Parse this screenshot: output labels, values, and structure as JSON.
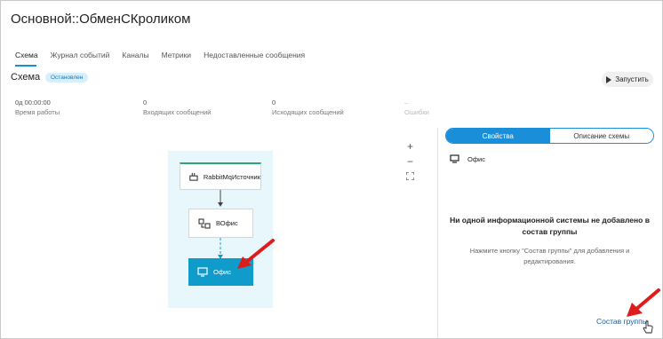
{
  "page": {
    "title": "Основной::ОбменСКроликом"
  },
  "tabs": [
    {
      "label": "Схема",
      "active": true
    },
    {
      "label": "Журнал событий",
      "active": false
    },
    {
      "label": "Каналы",
      "active": false
    },
    {
      "label": "Метрики",
      "active": false
    },
    {
      "label": "Недоставленные сообщения",
      "active": false
    }
  ],
  "schema": {
    "title": "Схема",
    "status": "Остановлен",
    "run_label": "Запустить"
  },
  "stats": [
    {
      "value": "0д 00:00:00",
      "label": "Время работы"
    },
    {
      "value": "0",
      "label": "Входящих сообщений"
    },
    {
      "value": "0",
      "label": "Исходящих сообщений"
    },
    {
      "value": "–",
      "label": "Ошибки"
    }
  ],
  "diagram": {
    "nodes": [
      {
        "label": "RabbitMqИсточник",
        "icon": "rabbit-icon"
      },
      {
        "label": "ВОфис",
        "icon": "transform-icon"
      },
      {
        "label": "Офис",
        "icon": "monitor-icon"
      }
    ],
    "zoom": {
      "in": "+",
      "out": "−",
      "fit": "fit-screen-icon"
    }
  },
  "panel": {
    "tabs": [
      {
        "label": "Свойства",
        "active": true
      },
      {
        "label": "Описание схемы",
        "active": false
      }
    ],
    "selected_name": "Офис",
    "empty_title": "Ни одной информационной системы не добавлено в состав группы",
    "empty_hint": "Нажмите кнопку \"Состав группы\" для добавления и редактирования.",
    "group_link": "Состав группы"
  },
  "colors": {
    "accent": "#1a8ed8",
    "node_active": "#0f9ccb",
    "annotation": "#e01b1b"
  }
}
